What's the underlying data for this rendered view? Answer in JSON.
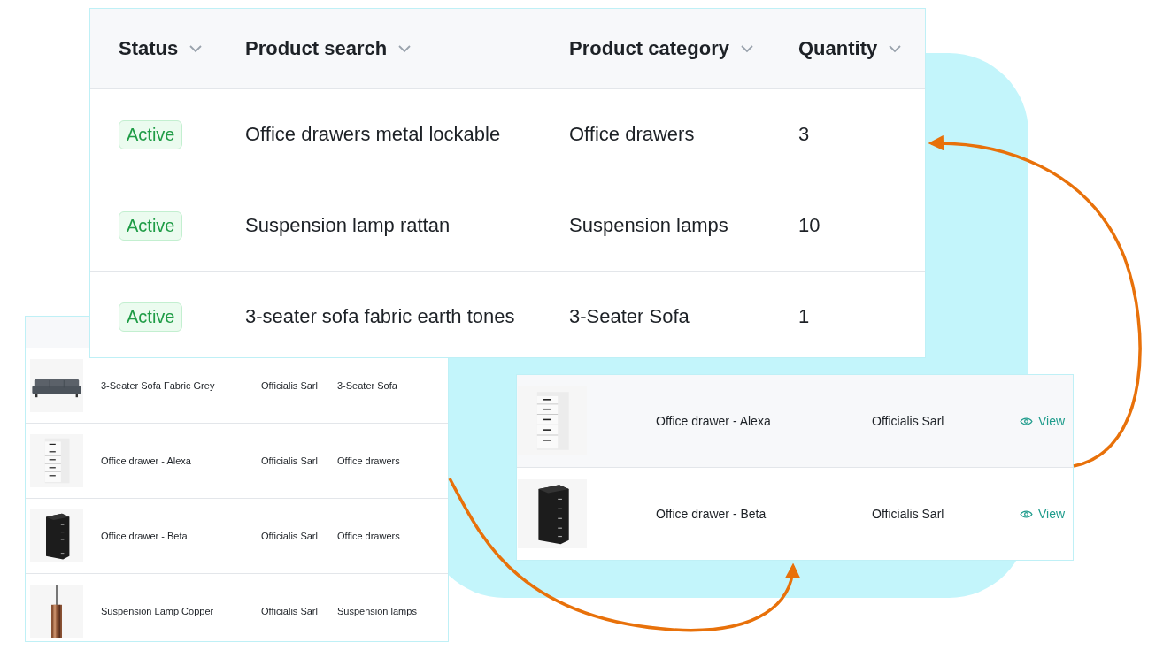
{
  "search_table": {
    "columns": [
      {
        "label": "Status"
      },
      {
        "label": "Product search"
      },
      {
        "label": "Product category"
      },
      {
        "label": "Quantity"
      }
    ],
    "rows": [
      {
        "status": "Active",
        "search": "Office drawers metal lockable",
        "category": "Office drawers",
        "quantity": "3"
      },
      {
        "status": "Active",
        "search": "Suspension lamp rattan",
        "category": "Suspension lamps",
        "quantity": "10"
      },
      {
        "status": "Active",
        "search": "3-seater sofa fabric earth tones",
        "category": "3-Seater Sofa",
        "quantity": "1"
      }
    ]
  },
  "catalog_list": {
    "rows": [
      {
        "name": "3-Seater Sofa Fabric Grey",
        "supplier": "Officialis Sarl",
        "category": "3-Seater Sofa"
      },
      {
        "name": "Office drawer - Alexa",
        "supplier": "Officialis Sarl",
        "category": "Office drawers"
      },
      {
        "name": "Office drawer - Beta",
        "supplier": "Officialis Sarl",
        "category": "Office drawers"
      },
      {
        "name": "Suspension Lamp Copper",
        "supplier": "Officialis Sarl",
        "category": "Suspension lamps"
      }
    ]
  },
  "matches": {
    "rows": [
      {
        "name": "Office drawer - Alexa",
        "supplier": "Officialis Sarl",
        "action": "View"
      },
      {
        "name": "Office drawer - Beta",
        "supplier": "Officialis Sarl",
        "action": "View"
      }
    ]
  }
}
